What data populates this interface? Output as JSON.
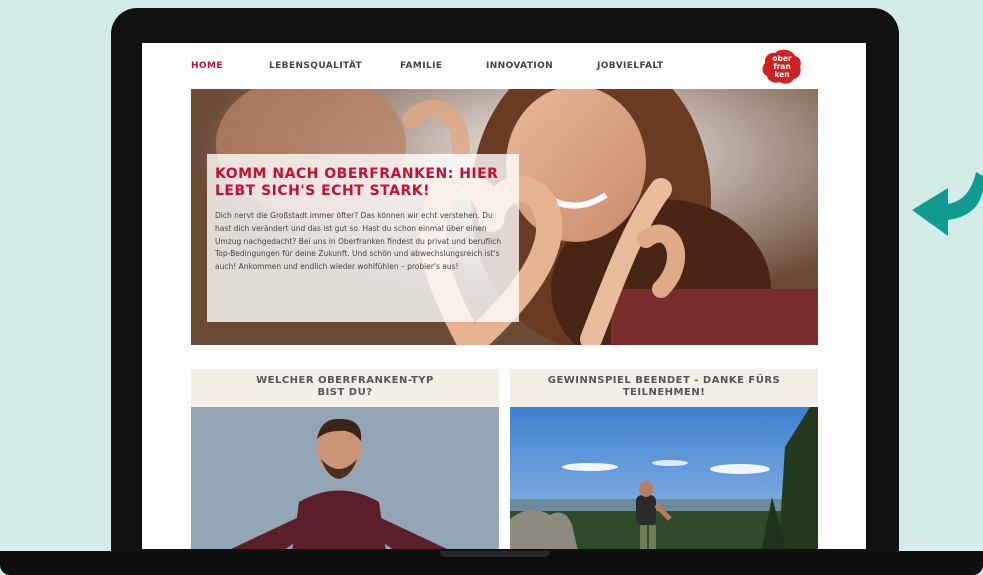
{
  "nav": {
    "items": [
      {
        "label": "HOME",
        "active": true
      },
      {
        "label": "LEBENSQUALITÄT",
        "active": false
      },
      {
        "label": "FAMILIE",
        "active": false
      },
      {
        "label": "INNOVATION",
        "active": false
      },
      {
        "label": "JOBVIELFALT",
        "active": false
      }
    ]
  },
  "logo": {
    "line1": "ober",
    "line2": "fran",
    "line3": "ken"
  },
  "hero": {
    "title": "Komm nach Oberfranken: hier lebt sich's echt stark!",
    "text": "Dich nervt die Großstadt immer öfter? Das können wir echt verstehen. Du hast dich verändert und das ist gut so. Hast du schon einmal über einen Umzug nachgedacht? Bei uns in Oberfranken findest du privat und beruflich Top-Bedingungen für deine Zukunft. Und schön und abwechslungsreich ist's auch! Ankommen und endlich wieder wohlfühlen – probier's aus!"
  },
  "cards": [
    {
      "title_line1": "Welcher Oberfranken-Typ",
      "title_line2": "bist du?"
    },
    {
      "title_line1": "Gewinnspiel beendet - Danke fürs",
      "title_line2": "Teilnehmen!"
    }
  ],
  "colors": {
    "accent": "#c8102e",
    "background": "#d4ece8",
    "arrow": "#0f9b8e",
    "card_header_bg": "#f3efe6"
  },
  "icons": {
    "arrow": "curved-arrow-left-icon"
  }
}
